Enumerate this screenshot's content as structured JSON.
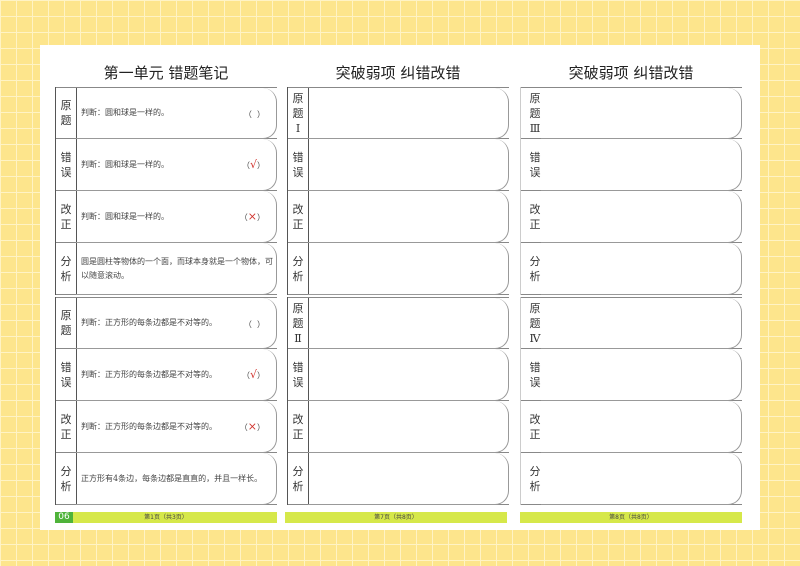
{
  "col1": {
    "title": "第一单元 错题笔记",
    "groups": [
      {
        "rows": [
          {
            "label": "原题",
            "text": "判断：圆和球是一样的。",
            "ans_open": "（",
            "mark": "",
            "ans_close": "）"
          },
          {
            "label": "错误",
            "text": "判断：圆和球是一样的。",
            "ans_open": "（",
            "mark": "√",
            "ans_close": "）"
          },
          {
            "label": "改正",
            "text": "判断：圆和球是一样的。",
            "ans_open": "（",
            "mark": "×",
            "ans_close": "）"
          },
          {
            "label": "分析",
            "text": "圆是圆柱等物体的一个面，而球本身就是一个物体，可以随意滚动。"
          }
        ]
      },
      {
        "rows": [
          {
            "label": "原题",
            "text": "判断：正方形的每条边都是不对等的。",
            "ans_open": "（",
            "mark": "",
            "ans_close": "）"
          },
          {
            "label": "错误",
            "text": "判断：正方形的每条边都是不对等的。",
            "ans_open": "（",
            "mark": "√",
            "ans_close": "）"
          },
          {
            "label": "改正",
            "text": "判断：正方形的每条边都是不对等的。",
            "ans_open": "（",
            "mark": "×",
            "ans_close": "）"
          },
          {
            "label": "分析",
            "text": "正方形有4条边，每条边都是直直的，并且一样长。"
          }
        ]
      }
    ],
    "page_num": "06",
    "footer": "第1页（共3页）"
  },
  "col2": {
    "title": "突破弱项 纠错改错",
    "labels": [
      "原题Ⅰ",
      "错误",
      "改正",
      "分析",
      "原题Ⅱ",
      "错误",
      "改正",
      "分析"
    ],
    "footer": "第7页（共8页）"
  },
  "col3": {
    "title": "突破弱项 纠错改错",
    "labels": [
      "原题Ⅲ",
      "错误",
      "改正",
      "分析",
      "原题Ⅳ",
      "错误",
      "改正",
      "分析"
    ],
    "footer": "第8页（共8页）"
  }
}
